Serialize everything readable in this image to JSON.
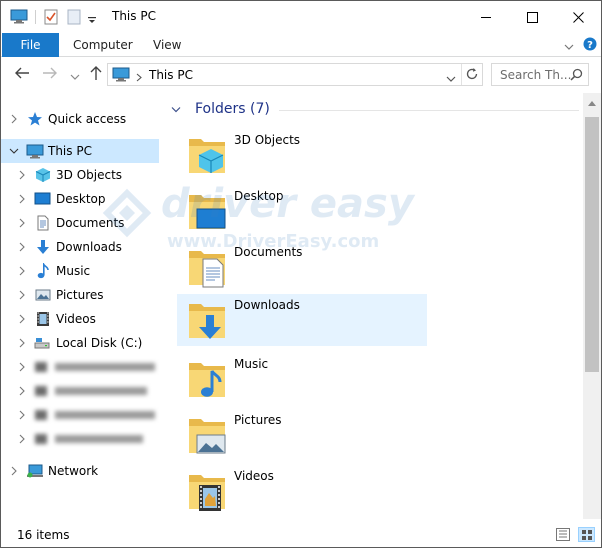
{
  "window": {
    "title": "This PC"
  },
  "ribbon": {
    "tabs": [
      {
        "label": "File"
      },
      {
        "label": "Computer"
      },
      {
        "label": "View"
      }
    ]
  },
  "address": {
    "path": "This PC",
    "search_placeholder": "Search Th..."
  },
  "nav": {
    "quick_access": "Quick access",
    "this_pc": "This PC",
    "children": [
      {
        "label": "3D Objects",
        "icon": "3d-objects-icon"
      },
      {
        "label": "Desktop",
        "icon": "desktop-icon"
      },
      {
        "label": "Documents",
        "icon": "documents-icon"
      },
      {
        "label": "Downloads",
        "icon": "downloads-icon"
      },
      {
        "label": "Music",
        "icon": "music-icon"
      },
      {
        "label": "Pictures",
        "icon": "pictures-icon"
      },
      {
        "label": "Videos",
        "icon": "videos-icon"
      },
      {
        "label": "Local Disk (C:)",
        "icon": "drive-icon"
      }
    ],
    "network": "Network"
  },
  "content": {
    "group_title": "Folders (7)",
    "folders": [
      {
        "label": "3D Objects"
      },
      {
        "label": "Desktop"
      },
      {
        "label": "Documents"
      },
      {
        "label": "Downloads"
      },
      {
        "label": "Music"
      },
      {
        "label": "Pictures"
      },
      {
        "label": "Videos"
      }
    ]
  },
  "watermark": {
    "logo_text": "driver easy",
    "url_text": "www.DriverEasy.com"
  },
  "status": {
    "count": "16 items"
  },
  "colors": {
    "accent": "#1979ca",
    "selection": "#cce8ff",
    "hover": "#e5f3ff",
    "group_title": "#1e3287",
    "folder": "#f8d775"
  }
}
